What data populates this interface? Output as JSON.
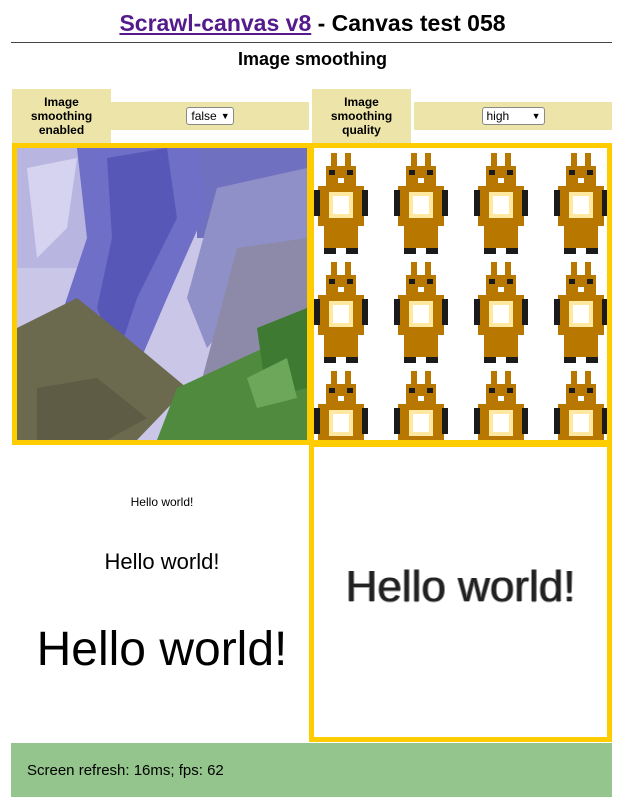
{
  "header": {
    "link_text": "Scrawl-canvas v8",
    "rest_text": " - Canvas test 058",
    "subtitle": "Image smoothing"
  },
  "controls": {
    "smoothing_enabled_label": "Image smoothing enabled",
    "smoothing_enabled_value": "false",
    "smoothing_quality_label": "Image smoothing quality",
    "smoothing_quality_value": "high"
  },
  "canvas": {
    "hello_small": "Hello world!",
    "hello_medium": "Hello world!",
    "hello_large": "Hello world!",
    "hello_pixelated": "Hello world!"
  },
  "status": {
    "text": "Screen refresh: 16ms; fps: 62"
  },
  "colors": {
    "frame_border": "#ffcc00",
    "control_bg": "#ece4a8",
    "status_bg": "#93c58c",
    "link": "#551a8b"
  }
}
